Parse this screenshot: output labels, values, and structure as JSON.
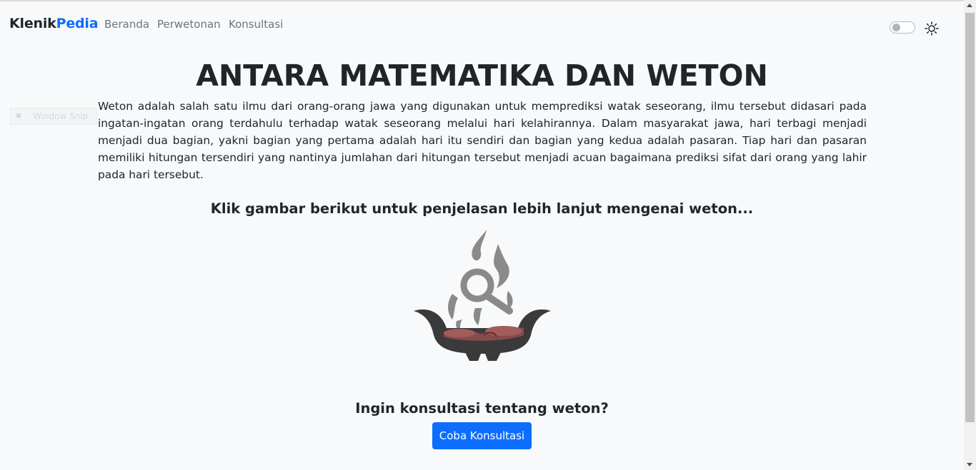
{
  "navbar": {
    "brand_part1": "Klenik",
    "brand_part2": "Pedia",
    "links": [
      "Beranda",
      "Perwetonan",
      "Konsultasi"
    ],
    "theme_icon": "sun-icon"
  },
  "overlay": {
    "snip_label": "Window Snip"
  },
  "main": {
    "title": "ANTARA MATEMATIKA DAN WETON",
    "intro": "Weton adalah salah satu ilmu dari orang-orang jawa yang digunakan untuk memprediksi watak seseorang, ilmu tersebut didasari pada ingatan-ingatan orang terdahulu terhadap watak seseorang melalui hari kelahirannya. Dalam masyarakat jawa, hari terbagi menjadi menjadi dua bagian, yakni bagian yang pertama adalah hari itu sendiri dan bagian yang kedua adalah pasaran. Tiap hari dan pasaran memiliki hitungan tersendiri yang nantinya jumlahan dari hitungan tersebut menjadi acuan bagaimana prediksi sifat dari orang yang lahir pada hari tersebut.",
    "click_prompt": "Klik gambar berikut untuk penjelasan lebih lanjut mengenai weton...",
    "image_icon": "incense-burner-magnifier-icon",
    "consult_prompt": "Ingin konsultasi tentang weton?",
    "consult_button": "Coba Konsultasi"
  },
  "colors": {
    "primary": "#0d6efd",
    "background": "#f8f9fa",
    "text": "#212529",
    "nav_text": "#6c757d"
  }
}
